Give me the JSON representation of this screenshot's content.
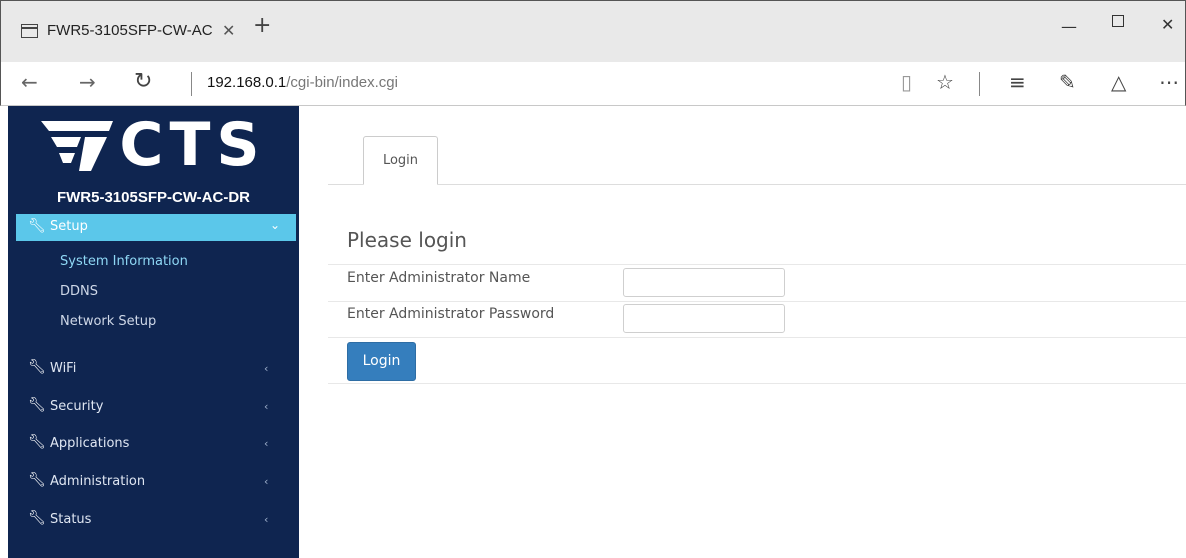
{
  "browser": {
    "tab_title": "FWR5-3105SFP-CW-AC",
    "tab_close": "✕",
    "new_tab": "+",
    "url_host": "192.168.0.1",
    "url_path": "/cgi-bin/index.cgi",
    "icons": {
      "back": "back-arrow-icon",
      "forward": "forward-arrow-icon",
      "refresh": "refresh-icon",
      "reading": "reading-view-icon",
      "favorite": "star-icon",
      "hub": "hub-icon",
      "notes": "web-note-icon",
      "share": "share-icon",
      "more": "more-icon"
    }
  },
  "sidebar": {
    "logo_text": "CTS",
    "model": "FWR5-3105SFP-CW-AC-DR",
    "active_menu": {
      "label": "Setup",
      "caret": "⌄"
    },
    "submenu": [
      {
        "label": "System Information",
        "active": true
      },
      {
        "label": "DDNS",
        "active": false
      },
      {
        "label": "Network Setup",
        "active": false
      }
    ],
    "menu": [
      {
        "label": "WiFi",
        "caret": "‹"
      },
      {
        "label": "Security",
        "caret": "‹"
      },
      {
        "label": "Applications",
        "caret": "‹"
      },
      {
        "label": "Administration",
        "caret": "‹"
      },
      {
        "label": "Status",
        "caret": "‹"
      }
    ],
    "accent_color": "#5bc7ea",
    "background_color": "#0f2550"
  },
  "main": {
    "tab_label": "Login",
    "title": "Please login",
    "fields": [
      {
        "label": "Enter Administrator Name",
        "value": ""
      },
      {
        "label": "Enter Administrator Password",
        "value": ""
      }
    ],
    "login_button": "Login",
    "button_color": "#357ebd"
  }
}
